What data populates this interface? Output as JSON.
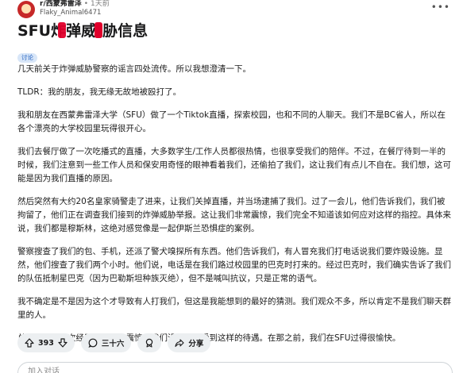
{
  "post": {
    "subreddit": "r/西蒙弗雷泽",
    "separator": "•",
    "time": "1天前",
    "username": "Flaky_Animal6471",
    "more_label": "•••",
    "title_parts": [
      "SFU炸",
      "弹威",
      "胁信息"
    ],
    "flair": "讨论",
    "paragraphs": [
      [
        "几天前关于",
        "炸弹威胁警",
        "察的谣言四处流传。所以我想澄清一下。"
      ],
      [
        "TLDR：我的朋友，我无缘无故地被殴打了。"
      ],
      [
        "我和朋友在西蒙弗雷泽大学（SFU）做了一个T",
        "iktok直播，探索校园，也和不同的人聊天。我们不是BC省人，所以在各个漂亮的大学校园里玩得很开心。"
      ],
      [
        "我们去餐厅做了一次吃播式的直播，大多数学生/工作人员都很热情，也很享受我们的陪伴。不过，在餐厅待到一半的时候，我们注意到一些工作人员和保安用奇怪的眼神看着我们，还偷拍了我们，这让我们有点儿不自在。我们想，这可能是因为我们直播的原因。"
      ],
      [
        "然后突然有大约20名皇家骑",
        "警走了进来，让我们关掉直播，并当场",
        "逮捕了我们。过了一会儿，他们告诉我们，我们被",
        "拘留了，他们正在调查我们接到的",
        "炸弹威胁",
        "举报。这让我们非常震惊，我们完全不知道该如何应对这样的指控。具体来说，我们都是",
        "穆斯林，这绝对感觉像是一起伊斯兰恐惧症的案例。"
      ],
      [
        "警察搜查了我们的包、手机，还派了警犬嗅探所有东西。他们告诉我们，有人冒充我们打电话说我们要",
        "炸毁设施。显然，",
        "他们搜查了我们两个小时。他们说，电话是在我们路过校园里的巴克时打来的。经过巴克时，我们确实告诉了我们的队伍抵制星巴克（因为巴",
        "勒斯",
        "坦种族灭绝",
        "），但不是喊叫抗议，只是正常的语气。"
      ],
      [
        "我不确定是不是因为这个才导致有人打我们，但这是我能想到的最好的猜测。我们观众不多，所以肯定不是我们聊天群里的人。"
      ],
      [
        "总的来说，这次经历非常令人震惊，我们没想到会受到这样的待遇。在那之前，我们在SFU过得很愉快。"
      ]
    ]
  },
  "actions": {
    "vote_count": "393",
    "comment_count": "三十六",
    "share_label": "分享"
  },
  "comment_box": {
    "placeholder": "加入对话"
  },
  "colors": {
    "redaction": "#e0002b",
    "flair_bg": "#d8e6f8",
    "flair_text": "#1f5fbf",
    "pill_bg": "#eceff1"
  }
}
